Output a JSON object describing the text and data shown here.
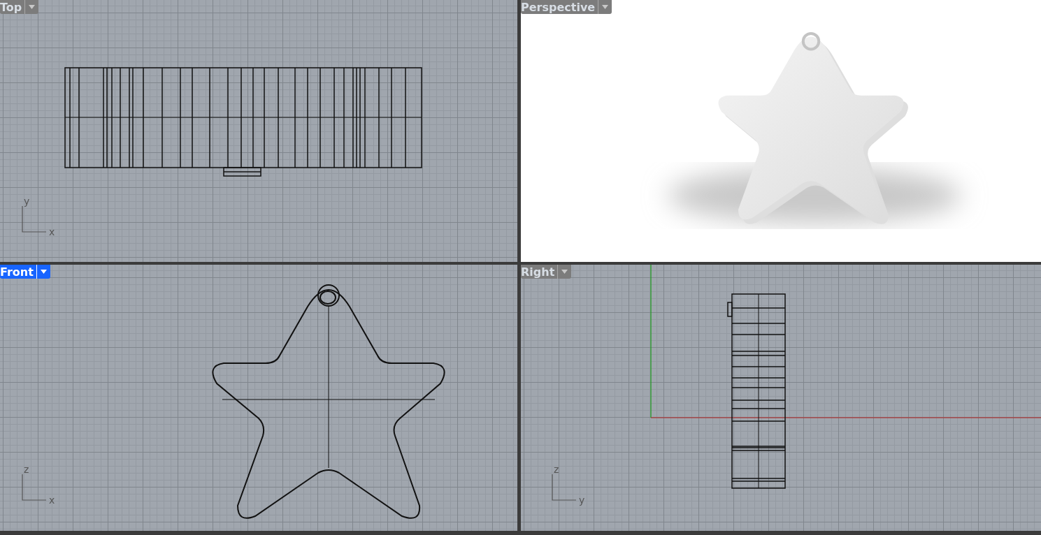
{
  "viewports": [
    {
      "label": "Top",
      "selected": false,
      "kind": "top",
      "axes": [
        "y",
        "x"
      ]
    },
    {
      "label": "Perspective",
      "selected": false,
      "kind": "perspective"
    },
    {
      "label": "Front",
      "selected": true,
      "kind": "front",
      "axes": [
        "z",
        "x"
      ]
    },
    {
      "label": "Right",
      "selected": false,
      "kind": "right",
      "axes": [
        "z",
        "y"
      ]
    }
  ]
}
